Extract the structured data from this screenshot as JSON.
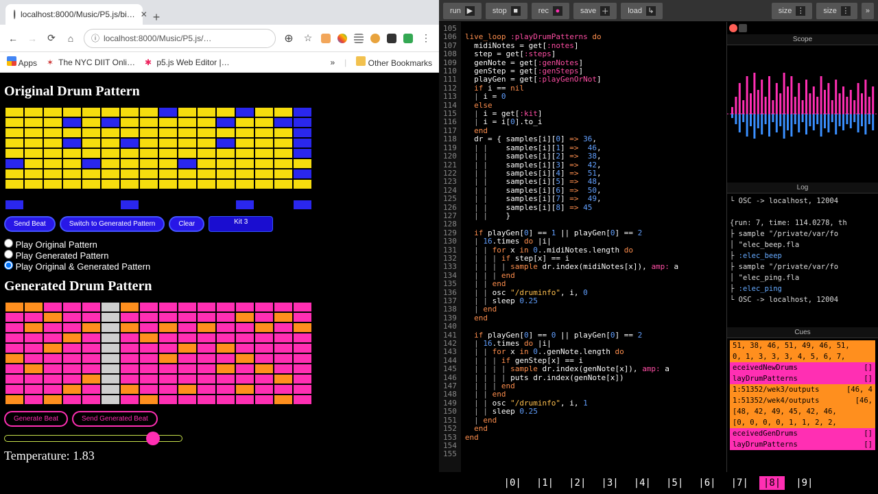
{
  "browser": {
    "tab_title": "localhost:8000/Music/P5.js/bi…",
    "address": "localhost:8000/Music/P5.js/…",
    "bookmarks": {
      "apps": "Apps",
      "nyc": "The NYC DIIT Onli…",
      "p5": "p5.js Web Editor |…",
      "other": "Other Bookmarks"
    }
  },
  "page": {
    "h_original": "Original Drum Pattern",
    "h_generated": "Generated Drum Pattern",
    "btn_send": "Send Beat",
    "btn_switch": "Switch to Generated Pattern",
    "btn_clear": "Clear",
    "kit_label": "Kit 3",
    "radio_original": "Play Original Pattern",
    "radio_generated": "Play Generated Pattern",
    "radio_both": "Play Original & Generated Pattern",
    "radio_selected": "both",
    "btn_generate": "Generate Beat",
    "btn_send_gen": "Send Generated Beat",
    "temperature_label": "Temperature: ",
    "temperature_value": "1.83",
    "slider_pct": 83,
    "grid_original": {
      "rows": 10,
      "cols": 16,
      "on": [
        [
          1,
          1,
          1,
          1,
          1,
          1,
          1,
          1,
          2,
          1,
          1,
          1,
          2,
          1,
          1,
          2
        ],
        [
          1,
          1,
          1,
          2,
          1,
          2,
          1,
          1,
          1,
          1,
          1,
          2,
          1,
          1,
          2,
          2
        ],
        [
          1,
          1,
          1,
          1,
          1,
          1,
          1,
          1,
          1,
          1,
          1,
          1,
          1,
          1,
          1,
          2
        ],
        [
          1,
          1,
          1,
          2,
          1,
          1,
          2,
          1,
          1,
          1,
          1,
          2,
          1,
          1,
          1,
          2
        ],
        [
          1,
          1,
          1,
          1,
          1,
          1,
          1,
          1,
          1,
          1,
          1,
          1,
          1,
          1,
          1,
          2
        ],
        [
          2,
          1,
          1,
          1,
          2,
          1,
          1,
          1,
          1,
          2,
          1,
          1,
          1,
          1,
          1,
          1
        ],
        [
          1,
          1,
          1,
          1,
          1,
          1,
          1,
          1,
          1,
          1,
          1,
          1,
          1,
          1,
          1,
          2
        ],
        [
          1,
          1,
          1,
          1,
          1,
          1,
          1,
          1,
          1,
          1,
          1,
          1,
          1,
          1,
          1,
          1
        ],
        [
          0,
          0,
          0,
          0,
          0,
          0,
          0,
          0,
          0,
          0,
          0,
          0,
          0,
          0,
          0,
          0
        ],
        [
          2,
          0,
          0,
          0,
          0,
          0,
          2,
          0,
          0,
          0,
          0,
          0,
          2,
          0,
          0,
          2
        ]
      ],
      "colors": {
        "0": "#000",
        "1": "#f6dd0e",
        "2": "#2a27ee"
      }
    },
    "grid_generated": {
      "rows": 10,
      "cols": 16,
      "on": [
        [
          2,
          2,
          1,
          1,
          1,
          3,
          2,
          1,
          1,
          1,
          1,
          1,
          1,
          1,
          1,
          1
        ],
        [
          1,
          1,
          2,
          1,
          1,
          3,
          1,
          1,
          1,
          1,
          1,
          1,
          2,
          1,
          2,
          1
        ],
        [
          1,
          2,
          1,
          1,
          2,
          3,
          2,
          1,
          2,
          1,
          2,
          1,
          1,
          2,
          1,
          2
        ],
        [
          1,
          1,
          1,
          2,
          1,
          3,
          1,
          2,
          1,
          1,
          1,
          1,
          1,
          1,
          1,
          1
        ],
        [
          1,
          1,
          2,
          1,
          1,
          3,
          1,
          1,
          1,
          2,
          1,
          2,
          1,
          1,
          1,
          1
        ],
        [
          2,
          1,
          1,
          1,
          1,
          3,
          1,
          1,
          2,
          1,
          1,
          1,
          2,
          1,
          1,
          1
        ],
        [
          1,
          2,
          1,
          1,
          1,
          3,
          1,
          1,
          1,
          1,
          1,
          2,
          1,
          2,
          1,
          1
        ],
        [
          1,
          1,
          1,
          1,
          2,
          3,
          1,
          1,
          1,
          1,
          1,
          1,
          1,
          1,
          2,
          1
        ],
        [
          1,
          1,
          1,
          2,
          1,
          3,
          2,
          1,
          1,
          2,
          1,
          1,
          2,
          1,
          1,
          1
        ],
        [
          2,
          1,
          2,
          1,
          1,
          3,
          1,
          2,
          1,
          1,
          1,
          1,
          1,
          1,
          2,
          1
        ]
      ],
      "colors": {
        "0": "#000",
        "1": "#ff2fb3",
        "2": "#ff8f1e",
        "3": "#cfcfcf"
      }
    }
  },
  "sonic": {
    "toolbar": {
      "run": "run",
      "stop": "stop",
      "rec": "rec",
      "save": "save",
      "load": "load",
      "size": "size",
      "size2": "size"
    },
    "line_start": 105,
    "code_lines": [
      "",
      "<k>live_loop</k> <s>:playDrumPatterns</s> <k>do</k>",
      "  midiNotes = get[<s>:notes</s>]",
      "  step = get[<s>:steps</s>]",
      "  genNote = get[<s>:genNotes</s>]",
      "  genStep = get[<s>:genSteps</s>]",
      "  playGen = get[<s>:playGenOrNot</s>]",
      "  <k>if</k> i == <k>nil</k>",
      "  <p>|</p> i = <n>0</n>",
      "  <k>else</k>",
      "  <p>|</p> i = get[<s>:kit</s>]",
      "  <p>|</p> i = i[<n>0</n>].to_i",
      "  <k>end</k>",
      "  dr = { samples[i][<n>0</n>] <k>=></k> <n>36</n>,",
      "  <p>| |</p>    samples[i][<n>1</n>] <k>=></k>  <n>46</n>,",
      "  <p>| |</p>    samples[i][<n>2</n>] <k>=></k>  <n>38</n>,",
      "  <p>| |</p>    samples[i][<n>3</n>] <k>=></k>  <n>42</n>,",
      "  <p>| |</p>    samples[i][<n>4</n>] <k>=></k>  <n>51</n>,",
      "  <p>| |</p>    samples[i][<n>5</n>] <k>=></k>  <n>48</n>,",
      "  <p>| |</p>    samples[i][<n>6</n>] <k>=></k>  <n>50</n>,",
      "  <p>| |</p>    samples[i][<n>7</n>] <k>=></k>  <n>49</n>,",
      "  <p>| |</p>    samples[i][<n>8</n>] <k>=></k> <n>45</n>",
      "  <p>| |</p>    }",
      "",
      "  <k>if</k> playGen[<n>0</n>] == <n>1</n> || playGen[<n>0</n>] == <n>2</n>",
      "  <p>|</p> <n>16</n>.times <k>do</k> |i|",
      "  <p>| |</p> <k>for</k> x <k>in</k> <n>0</n>..midiNotes.length <k>do</k>",
      "  <p>| | |</p> <k>if</k> step[x] == i",
      "  <p>| | | |</p> <k>sample</k> dr.index(midiNotes[x]), <s>amp:</s> a",
      "  <p>| | |</p> <k>end</k>",
      "  <p>| |</p> <k>end</k>",
      "  <p>| |</p> osc <o>\"/druminfo\"</o>, i, <n>0</n>",
      "  <p>| |</p> sleep <n>0.25</n>",
      "  <p>|</p> <k>end</k>",
      "  <k>end</k>",
      "",
      "  <k>if</k> playGen[<n>0</n>] == <n>0</n> || playGen[<n>0</n>] == <n>2</n>",
      "  <p>|</p> <n>16</n>.times <k>do</k> |i|",
      "  <p>| |</p> <k>for</k> x <k>in</k> <n>0</n>..genNote.length <k>do</k>",
      "  <p>| | |</p> <k>if</k> genStep[x] == i",
      "  <p>| | | |</p> <k>sample</k> dr.index(genNote[x]), <s>amp:</s> a",
      "  <p>| | | |</p> puts dr.index(genNote[x])",
      "  <p>| | |</p> <k>end</k>",
      "  <p>| |</p> <k>end</k>",
      "  <p>| |</p> osc <o>\"/druminfo\"</o>, i, <n>1</n>",
      "  <p>| |</p> sleep <n>0.25</n>",
      "  <p>|</p> <k>end</k>",
      "  <k>end</k>",
      "<k>end</k>",
      "",
      ""
    ],
    "scope_label": "Scope",
    "log_label": "Log",
    "log_lines": [
      "└ OSC -> localhost, 12004",
      "",
      "{run: 7, time: 114.0278, th",
      "├ sample \"/private/var/fo",
      "│         \"elec_beep.fla",
      "├ <sym>:elec_beep</sym>",
      "├ sample \"/private/var/fo",
      "│         \"elec_ping.fla",
      "├ <sym>:elec_ping</sym>",
      "└ OSC -> localhost, 12004"
    ],
    "cues_label": "Cues",
    "cues_rows": [
      {
        "c": "o",
        "l": "51, 38, 46, 51, 49, 46, 51,",
        "r": ""
      },
      {
        "c": "o",
        "l": "0, 1, 3, 3, 3, 4, 5, 6, 7,",
        "r": ""
      },
      {
        "c": "m",
        "l": "eceivedNewDrums",
        "r": "[]"
      },
      {
        "c": "m",
        "l": "layDrumPatterns",
        "r": "[]"
      },
      {
        "c": "o",
        "l": "1:51352/wek3/outputs",
        "r": "[46, 4"
      },
      {
        "c": "o",
        "l": "1:51352/wek4/outputs",
        "r": "[46, "
      },
      {
        "c": "o",
        "l": "[48, 42, 49, 45, 42, 46,",
        "r": ""
      },
      {
        "c": "o",
        "l": "[0, 0, 0, 0, 1, 1, 2, 2,",
        "r": ""
      },
      {
        "c": "m",
        "l": "eceivedGenDrums",
        "r": "[]"
      },
      {
        "c": "m",
        "l": "layDrumPatterns",
        "r": "[]"
      }
    ],
    "buffers": [
      "|0|",
      "|1|",
      "|2|",
      "|3|",
      "|4|",
      "|5|",
      "|6|",
      "|7|",
      "|8|",
      "|9|"
    ],
    "buffer_active": 8
  }
}
